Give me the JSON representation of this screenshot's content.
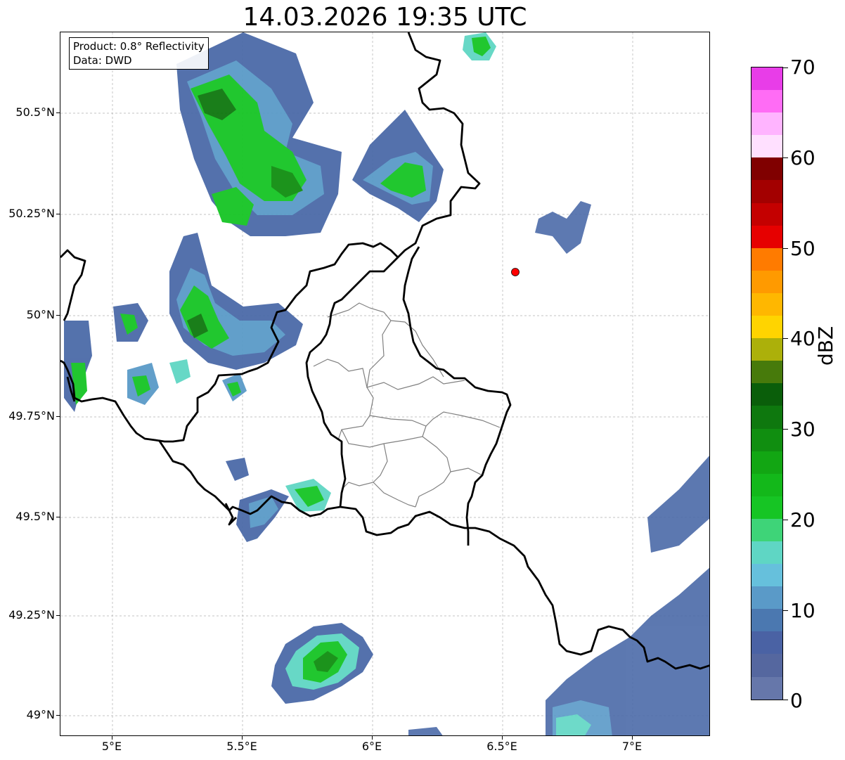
{
  "title": "14.03.2026 19:35 UTC",
  "info": {
    "product": "Product: 0.8° Reflectivity",
    "source": "Data: DWD"
  },
  "axes": {
    "lon_ticks": [
      "5°E",
      "5.5°E",
      "6°E",
      "6.5°E",
      "7°E"
    ],
    "lat_ticks": [
      "50.5°N",
      "50.25°N",
      "50°N",
      "49.75°N",
      "49.5°N",
      "49.25°N",
      "49°N"
    ],
    "lon_range": [
      4.8,
      7.3
    ],
    "lat_range": [
      48.95,
      50.7
    ]
  },
  "colorbar": {
    "label": "dBZ",
    "ticks": [
      "0",
      "10",
      "20",
      "30",
      "40",
      "50",
      "60",
      "70"
    ],
    "colors": [
      "#6677aa",
      "#55679f",
      "#4a62a4",
      "#4b78b0",
      "#5a9ac8",
      "#66c0dc",
      "#5fd6c4",
      "#3ed478",
      "#16c524",
      "#13b81a",
      "#12a613",
      "#108e10",
      "#0e780e",
      "#0a5e0a",
      "#477a0b",
      "#acb00a",
      "#ffd400",
      "#ffb700",
      "#ff9a00",
      "#ff7b00",
      "#e60000",
      "#c40000",
      "#a30000",
      "#800000",
      "#ffe0ff",
      "#ffb4ff",
      "#ff6cf5",
      "#e83de8"
    ]
  },
  "radar_site": {
    "color": "#ff0000"
  },
  "colors": {
    "border": "#000000",
    "admin": "#808080",
    "grid": "#b0b0b0"
  }
}
